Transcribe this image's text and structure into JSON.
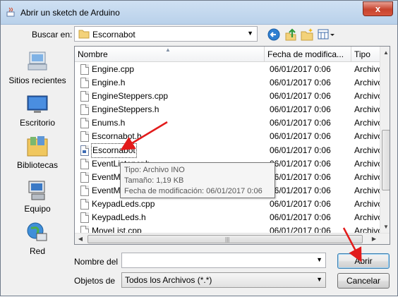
{
  "window": {
    "title": "Abrir un sketch de Arduino",
    "close_label": "x"
  },
  "lookin": {
    "label": "Buscar en:",
    "value": "Escornabot",
    "dropdown_glyph": "▼"
  },
  "toolbar": {
    "back_icon": "back-arrow-icon",
    "up_icon": "up-folder-icon",
    "new_folder_icon": "new-folder-icon",
    "view_menu_icon": "view-menu-icon"
  },
  "places": [
    {
      "label": "Sitios recientes",
      "icon": "recent-places-icon"
    },
    {
      "label": "Escritorio",
      "icon": "desktop-icon"
    },
    {
      "label": "Bibliotecas",
      "icon": "libraries-icon"
    },
    {
      "label": "Equipo",
      "icon": "computer-icon"
    },
    {
      "label": "Red",
      "icon": "network-icon"
    }
  ],
  "columns": {
    "name": "Nombre",
    "date": "Fecha de modifica...",
    "type": "Tipo"
  },
  "files": [
    {
      "name": "Engine.cpp",
      "date": "06/01/2017 0:06",
      "type": "Archivo"
    },
    {
      "name": "Engine.h",
      "date": "06/01/2017 0:06",
      "type": "Archivo"
    },
    {
      "name": "EngineSteppers.cpp",
      "date": "06/01/2017 0:06",
      "type": "Archivo"
    },
    {
      "name": "EngineSteppers.h",
      "date": "06/01/2017 0:06",
      "type": "Archivo"
    },
    {
      "name": "Enums.h",
      "date": "06/01/2017 0:06",
      "type": "Archivo"
    },
    {
      "name": "Escornabot.h",
      "date": "06/01/2017 0:06",
      "type": "Archivo"
    },
    {
      "name": "Escornabot",
      "date": "06/01/2017 0:06",
      "type": "Archivo"
    },
    {
      "name": "EventListener.h",
      "date": "06/01/2017 0:06",
      "type": "Archivo"
    },
    {
      "name": "EventManager.cpp",
      "date": "06/01/2017 0:06",
      "type": "Archivo"
    },
    {
      "name": "EventManager.h",
      "date": "06/01/2017 0:06",
      "type": "Archivo"
    },
    {
      "name": "KeypadLeds.cpp",
      "date": "06/01/2017 0:06",
      "type": "Archivo"
    },
    {
      "name": "KeypadLeds.h",
      "date": "06/01/2017 0:06",
      "type": "Archivo"
    },
    {
      "name": "MoveList.cpp",
      "date": "06/01/2017 0:06",
      "type": "Archivo"
    }
  ],
  "tooltip": {
    "line1": "Tipo: Archivo INO",
    "line2": "Tamaño: 1,19 KB",
    "line3": "Fecha de modificación: 06/01/2017 0:06"
  },
  "filename": {
    "label": "Nombre del",
    "value": ""
  },
  "filetype": {
    "label": "Objetos de",
    "value": "Todos los Archivos (*.*)"
  },
  "buttons": {
    "open": "Abrir",
    "cancel": "Cancelar"
  },
  "colors": {
    "annotation_arrow": "#e21b1b",
    "titlebar": "#c4d9f0"
  }
}
